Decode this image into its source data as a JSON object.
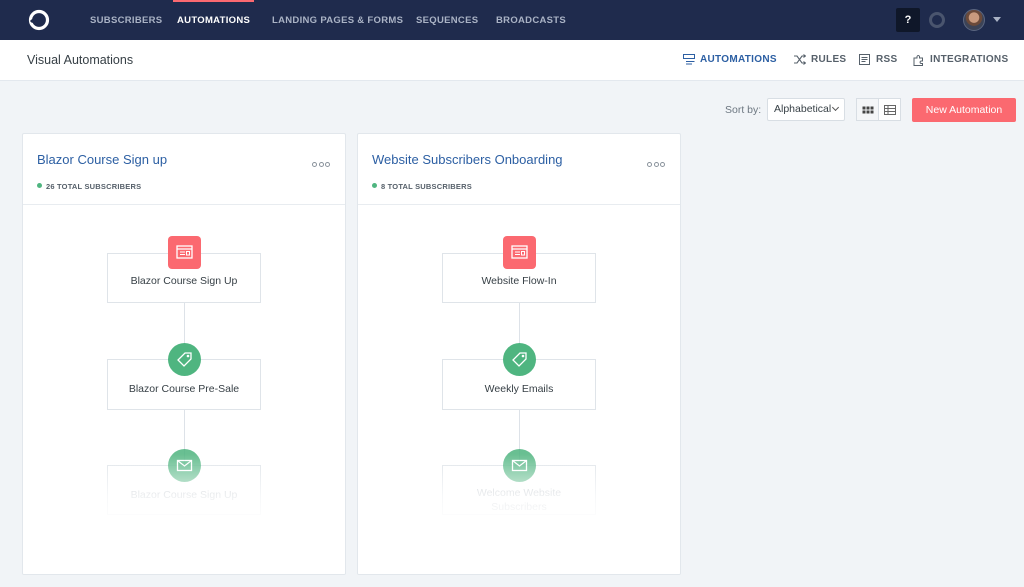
{
  "topnav": {
    "items": [
      "SUBSCRIBERS",
      "AUTOMATIONS",
      "LANDING PAGES & FORMS",
      "SEQUENCES",
      "BROADCASTS"
    ],
    "active": "AUTOMATIONS",
    "help_label": "?",
    "accent_color": "#fb6970",
    "background": "#1f2b4d"
  },
  "subheader": {
    "title": "Visual Automations",
    "tabs": [
      {
        "label": "AUTOMATIONS",
        "icon": "automations-icon",
        "active": true
      },
      {
        "label": "RULES",
        "icon": "shuffle-icon"
      },
      {
        "label": "RSS",
        "icon": "rss-icon"
      },
      {
        "label": "INTEGRATIONS",
        "icon": "puzzle-icon"
      }
    ]
  },
  "toolbar": {
    "sort_label": "Sort by:",
    "sort_value": "Alphabetical",
    "new_button": "New Automation"
  },
  "cards": [
    {
      "title": "Blazor Course Sign up",
      "subscribers": "26 TOTAL SUBSCRIBERS",
      "nodes": [
        {
          "type": "form",
          "label": "Blazor Course Sign Up"
        },
        {
          "type": "tag",
          "label": "Blazor Course Pre-Sale"
        },
        {
          "type": "email",
          "label": "Blazor Course Sign Up"
        }
      ]
    },
    {
      "title": "Website Subscribers Onboarding",
      "subscribers": "8 TOTAL SUBSCRIBERS",
      "nodes": [
        {
          "type": "form",
          "label": "Website Flow-In"
        },
        {
          "type": "tag",
          "label": "Weekly Emails"
        },
        {
          "type": "email",
          "label_line1": "Welcome Website",
          "label_line2": "Subscribers"
        }
      ]
    }
  ]
}
